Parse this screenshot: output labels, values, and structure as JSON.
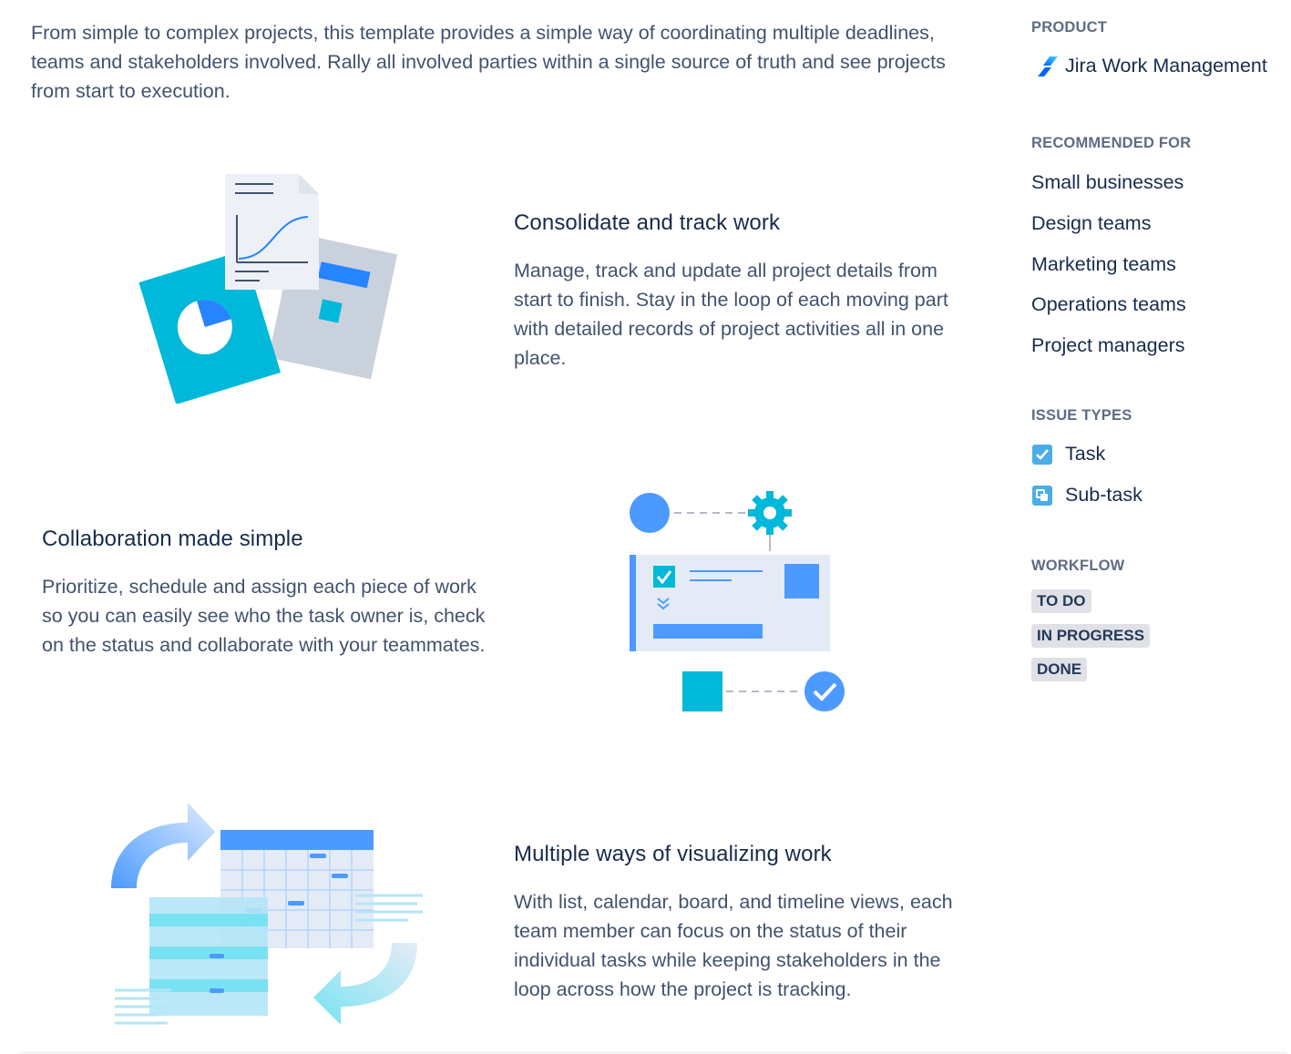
{
  "intro": "From simple to complex projects, this template provides a simple way of coordinating multiple deadlines, teams and stakeholders involved. Rally all involved parties within a single source of truth and see projects from start to execution.",
  "features": [
    {
      "title": "Consolidate and track work",
      "text": "Manage, track and update all project details from start to finish. Stay in the loop of each moving part with detailed records of project activities all in one place."
    },
    {
      "title": "Collaboration made simple",
      "text": "Prioritize, schedule and assign each piece of work so you can easily see who the task owner is, check on the status and collaborate with your teammates."
    },
    {
      "title": "Multiple ways of visualizing work",
      "text": "With list, calendar, board, and timeline views, each team member can focus on the status of their individual tasks while keeping stakeholders in the loop across how the project is tracking."
    }
  ],
  "sidebar": {
    "product_heading": "PRODUCT",
    "product_name": "Jira Work Management",
    "product_icon": "jira-work-management-logo",
    "recommended_heading": "RECOMMENDED FOR",
    "recommended": [
      "Small businesses",
      "Design teams",
      "Marketing teams",
      "Operations teams",
      "Project managers"
    ],
    "issue_types_heading": "ISSUE TYPES",
    "issue_types": [
      {
        "label": "Task",
        "icon": "task-checkbox-icon"
      },
      {
        "label": "Sub-task",
        "icon": "subtask-icon"
      }
    ],
    "workflow_heading": "WORKFLOW",
    "workflow": [
      "TO DO",
      "IN PROGRESS",
      "DONE"
    ]
  },
  "colors": {
    "accent_blue": "#00b8d9",
    "brand_blue": "#0065ff",
    "text_primary": "#172b4d",
    "text_secondary": "#42526e",
    "lozenge_bg": "#dfe1e6"
  }
}
